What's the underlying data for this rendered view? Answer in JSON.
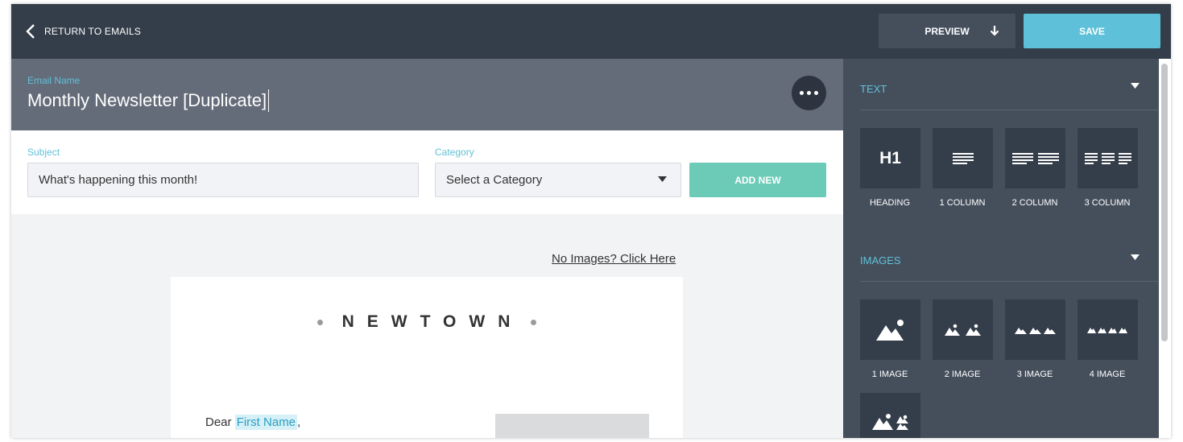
{
  "topbar": {
    "back_label": "RETURN TO EMAILS",
    "preview_label": "PREVIEW",
    "save_label": "SAVE"
  },
  "email_name": {
    "label": "Email Name",
    "value": "Monthly Newsletter [Duplicate]"
  },
  "subject": {
    "label": "Subject",
    "value": "What's happening this month!"
  },
  "category": {
    "label": "Category",
    "selected": "Select a Category",
    "add_new_label": "ADD NEW"
  },
  "canvas": {
    "no_images_link": "No Images? Click Here",
    "logo_text": "NEWTOWN",
    "greeting_prefix": "Dear ",
    "merge_tag": "First Name",
    "greeting_suffix": ","
  },
  "sidebar": {
    "text_section": {
      "title": "TEXT",
      "tiles": [
        {
          "label": "HEADING",
          "glyph": "H1",
          "icon": "heading-icon"
        },
        {
          "label": "1 COLUMN",
          "icon": "one-column-text-icon"
        },
        {
          "label": "2 COLUMN",
          "icon": "two-column-text-icon"
        },
        {
          "label": "3 COLUMN",
          "icon": "three-column-text-icon"
        }
      ]
    },
    "images_section": {
      "title": "IMAGES",
      "tiles": [
        {
          "label": "1 IMAGE",
          "icon": "one-image-icon"
        },
        {
          "label": "2 IMAGE",
          "icon": "two-image-icon"
        },
        {
          "label": "3 IMAGE",
          "icon": "three-image-icon"
        },
        {
          "label": "4 IMAGE",
          "icon": "four-image-icon"
        },
        {
          "label": "",
          "icon": "image-text-icon"
        }
      ]
    }
  },
  "colors": {
    "topbar": "#343d4a",
    "accent": "#5fc1d9",
    "add_new": "#6ccbb7",
    "sidebar": "#454f5c",
    "name_header": "#646b79"
  }
}
